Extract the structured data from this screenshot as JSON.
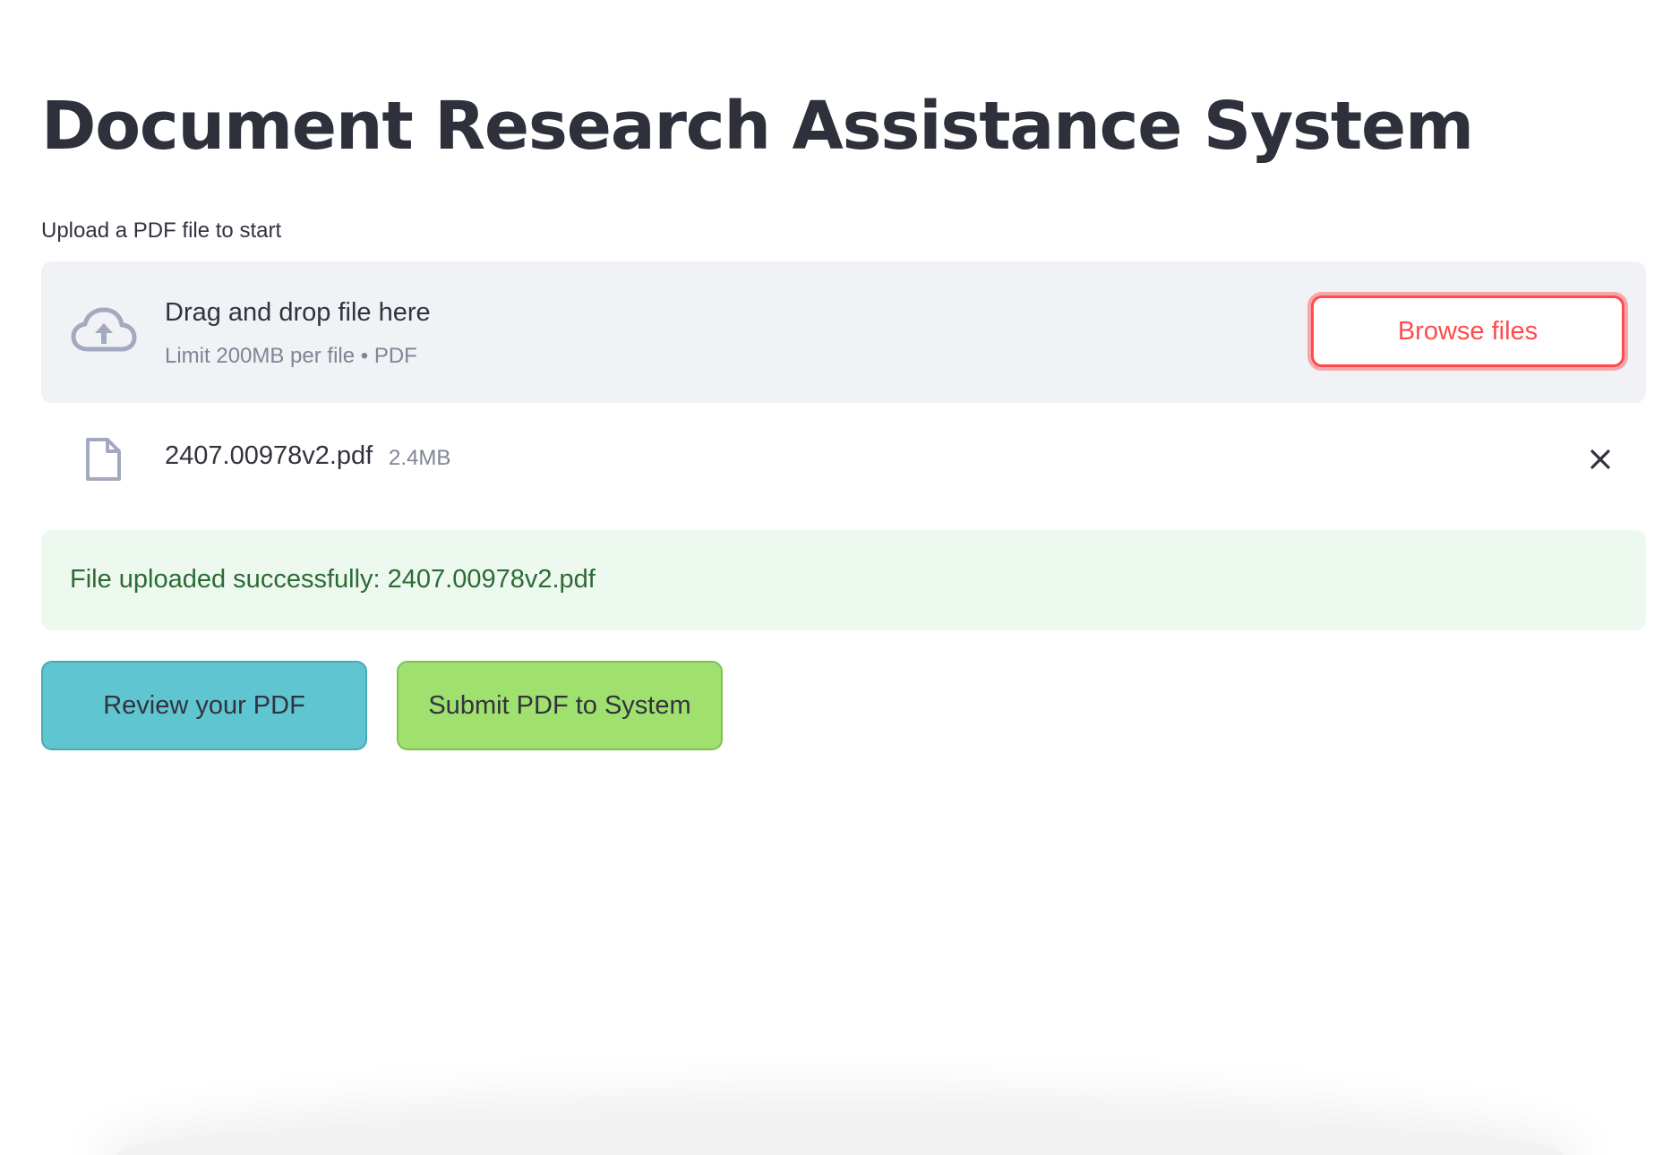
{
  "page": {
    "title": "Document Research Assistance System"
  },
  "uploader": {
    "label": "Upload a PDF file to start",
    "drop_title": "Drag and drop file here",
    "drop_limit": "Limit 200MB per file • PDF",
    "browse_label": "Browse files",
    "icon": "cloud-upload-icon"
  },
  "uploaded_file": {
    "name": "2407.00978v2.pdf",
    "size": "2.4MB",
    "icon": "file-icon",
    "remove_icon": "close-icon"
  },
  "status": {
    "message": "File uploaded successfully: 2407.00978v2.pdf"
  },
  "actions": {
    "review_label": "Review your PDF",
    "submit_label": "Submit PDF to System"
  },
  "colors": {
    "accent": "#ff4b4b",
    "dropzone_bg": "#f0f2f6",
    "success_bg": "#edf8ef",
    "success_text": "#2b6b35",
    "review_bg": "#5fc6d1",
    "submit_bg": "#a0e06e"
  }
}
